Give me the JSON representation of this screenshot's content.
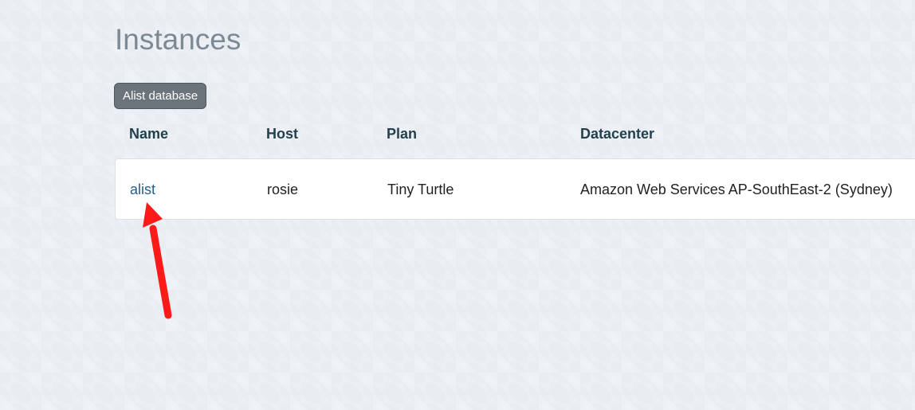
{
  "page": {
    "title": "Instances"
  },
  "filter": {
    "label": "Alist database"
  },
  "table": {
    "columns": [
      "Name",
      "Host",
      "Plan",
      "Datacenter"
    ],
    "rows": [
      {
        "name": "alist",
        "host": "rosie",
        "plan": "Tiny Turtle",
        "datacenter": "Amazon Web Services AP-SouthEast-2 (Sydney)"
      }
    ]
  },
  "colors": {
    "background": "#e9edf2",
    "title": "#7d8a96",
    "chip_background": "#6b737b",
    "header_text": "#23414d",
    "link": "#1f5f8f",
    "annotation_arrow": "#ff1a1a"
  },
  "annotation": {
    "icon": "red-arrow-icon"
  }
}
